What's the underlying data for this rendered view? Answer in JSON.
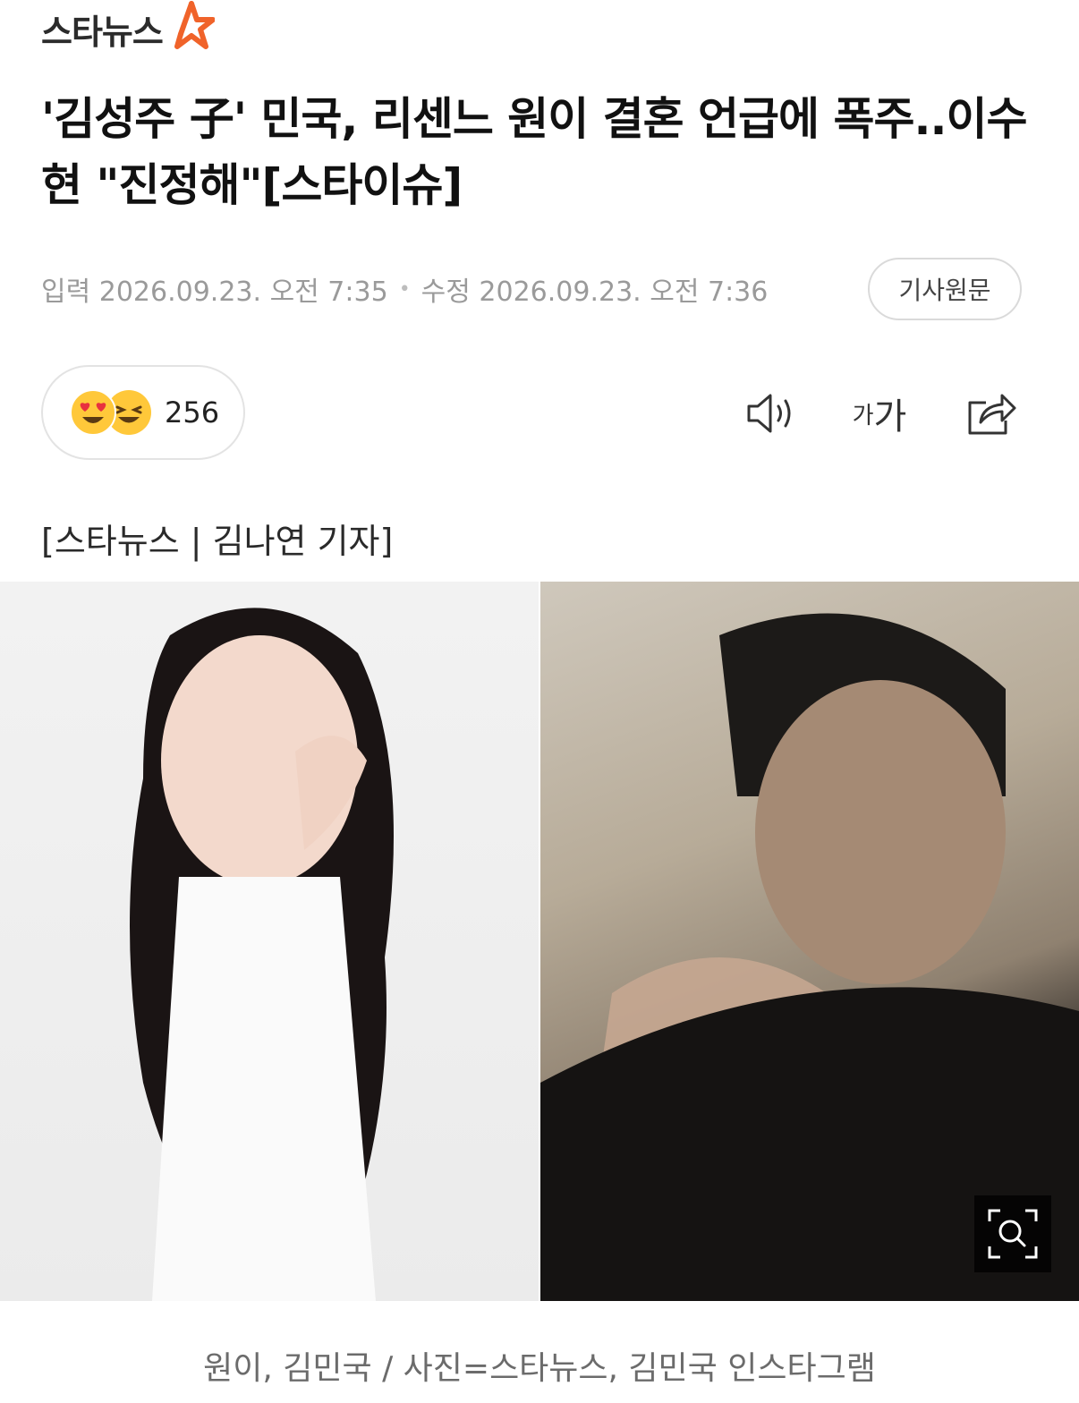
{
  "header": {
    "logo_text": "스타뉴스"
  },
  "article": {
    "headline": "'김성주 子' 민국, 리센느 원이 결혼 언급에 폭주..이수현 \"진정해\"[스타이슈]",
    "published": "입력 2026.09.23. 오전 7:35",
    "modified": "수정 2026.09.23. 오전 7:36",
    "origin_button": "기사원문",
    "reaction_count": "256",
    "byline": "[스타뉴스 | 김나연 기자]",
    "photo_caption": "원이, 김민국 / 사진=스타뉴스, 김민국 인스타그램"
  },
  "toolbar": {
    "font_small": "가",
    "font_large": "가"
  },
  "icons": {
    "logo": "star-logo-icon",
    "reaction_1": "heart-eyes-emoji-icon",
    "reaction_2": "laughing-emoji-icon",
    "tts": "speaker-icon",
    "font": "font-size-icon",
    "share": "share-icon",
    "zoom": "zoom-search-icon"
  },
  "colors": {
    "logo_star": "#f0632a",
    "emoji_yellow": "#ffc83a",
    "meta_gray": "#9a9a9a"
  }
}
